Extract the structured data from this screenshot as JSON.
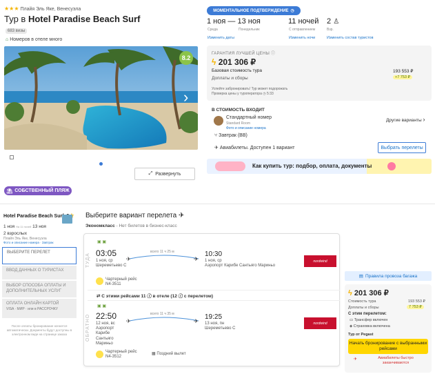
{
  "hotel": {
    "location": "Плайя Эль Яке, Венесуэла",
    "title_prefix": "Тур в ",
    "title_name": "Hotel Paradise Beach Surf",
    "views": "683 визы",
    "rooms_note": "Номеров в отеле много",
    "rating": "8.2",
    "expand_label": "Развернуть",
    "own_beach": "СОБСТВЕННЫЙ ПЛЯЖ"
  },
  "booking": {
    "instant_label": "МОМЕНТАЛЬНОЕ ПОДТВЕРЖДЕНИЕ",
    "date_from": "1 ноя",
    "date_from_day": "Среда",
    "date_to": "13 ноя",
    "date_to_day": "Понедельник",
    "nights": "11 ночей",
    "nights_sub": "С отправлением",
    "guests": "2",
    "guests_sub": "Взр.",
    "change_dates": "Изменить даты",
    "change_nights": "Изменить ночи",
    "change_tourists": "Изменить состав туристов"
  },
  "price_card": {
    "guarantee": "ГАРАНТИЯ ЛУЧШЕЙ ЦЕНЫ",
    "price": "201 306 ₽",
    "base_label": "Базовая стоимость тура",
    "base_value": "193 553 ₽",
    "fees_label": "Доплаты и сборы",
    "fees_value": "+7 753 ₽",
    "note1": "Успейте забронировать! Тур может подорожать",
    "note2": "Проверка цены у туроператора",
    "note2_time": "5:33",
    "includes_title": "В СТОИМОСТЬ ВХОДИТ",
    "room": "Стандартный номер",
    "room_sub": "Standard Room",
    "room_link": "Фото и описание номера",
    "other_options": "Другие варианты",
    "meal": "Завтрак (BB)",
    "flight": "Авиабилеты. Доступен 1 вариант",
    "choose_flight": "Выбрать перелеты",
    "banner": "Как купить тур: подбор, оплата, документы"
  },
  "sidebar": {
    "hotel_name": "Hotel Paradise Beach Surf, 3",
    "dates_from": "1 ноя",
    "dates_mid": "На 11 ночей",
    "dates_to": "13 ноя",
    "tourists": "2 взрослых",
    "location": "Плайя Эль Яке, Венесуэла",
    "links": "Фото и описание номера · Завтрак",
    "steps": [
      "ВЫБЕРИТЕ ПЕРЕЛЕТ",
      "ВВОД ДАННЫХ О ТУРИСТАХ",
      "ВЫБОР СПОСОБА ОПЛАТЫ И ДОПОЛНИТЕЛЬНЫХ УСЛУГ",
      "ОПЛАТА ОНЛАЙН КАРТОЙ"
    ],
    "pay_methods": "VISA · МИР · или в РАССРОЧКУ",
    "footer": "После оплаты бронирование начнется автоматически. Документы будут доступны в электронном виде на странице заказа"
  },
  "flights": {
    "title": "Выберите вариант перелета",
    "class_label": "Экономкласс",
    "class_note": " - Нет билетов в бизнес-класс",
    "there_label": "ТУДА",
    "back_label": "ОБРАТНО",
    "out_dep_time": "03:05",
    "out_dep_date": "1 ноя, ср",
    "out_dep_airport": "Шереметьево С",
    "out_duration": "всего 11 ч 25 м",
    "out_arr_time": "10:30",
    "out_arr_date": "1 ноя, ср",
    "out_arr_airport": "Аэропорт Карибе Сантьяго Мариньо",
    "out_type": "Чартерный рейс",
    "out_num": "N4-3511",
    "combo_note": "С этими рейсами 11 ⓘ в отеле (12 ⓘ с перелетом)",
    "ret_dep_time": "22:50",
    "ret_dep_date": "12 ноя, вс",
    "ret_dep_airport": "Аэропорт Карибе Сантьяго Мариньо",
    "ret_duration": "всего 11 ч 35 м",
    "ret_arr_time": "19:25",
    "ret_arr_date": "13 ноя, пн",
    "ret_arr_airport": "Шереметьево С",
    "ret_type": "Чартерный рейс",
    "ret_num": "N4-3512",
    "late_departure": "Поздний вылет",
    "airline": "nordwind"
  },
  "summary": {
    "baggage_rules": "Правила провоза багажа",
    "price": "201 306 ₽",
    "tour_cost_label": "Стоимость тура",
    "tour_cost_value": "193 553 ₽",
    "fees_label": "Доплаты и сборы",
    "fees_value": "7 753 ₽",
    "with_flight": "С этим перелетом:",
    "transfer": "Трансфер включен",
    "insurance": "Страховка включена",
    "operator": "Тур от Pegast",
    "book_btn": "Начать бронирование с выбранными рейсами",
    "sellout": "Авиабилеты быстро заканчиваются"
  },
  "colors": {
    "accent": "#3c7bd6",
    "yellow": "#ffd600",
    "purple": "#7e57c2",
    "rating": "#8bc34a",
    "airline": "#c8102e"
  }
}
